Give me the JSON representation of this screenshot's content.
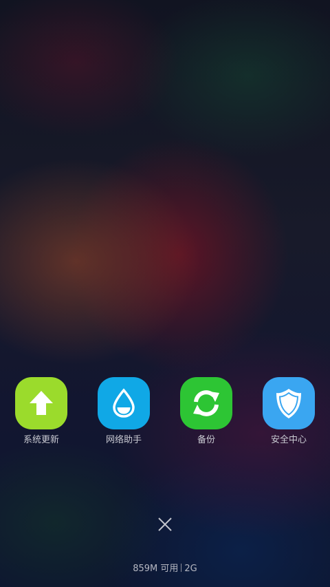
{
  "apps": [
    {
      "label": "系统更新",
      "icon": "upload-arrow-icon",
      "color": "#9bdb2c"
    },
    {
      "label": "网络助手",
      "icon": "water-drop-icon",
      "color": "#10a8e6"
    },
    {
      "label": "备份",
      "icon": "sync-icon",
      "color": "#2dc534"
    },
    {
      "label": "安全中心",
      "icon": "shield-icon",
      "color": "#3aa6f1"
    }
  ],
  "close_button": {
    "icon": "close-icon"
  },
  "status": {
    "memory_free": "859M 可用",
    "memory_total": "2G"
  }
}
